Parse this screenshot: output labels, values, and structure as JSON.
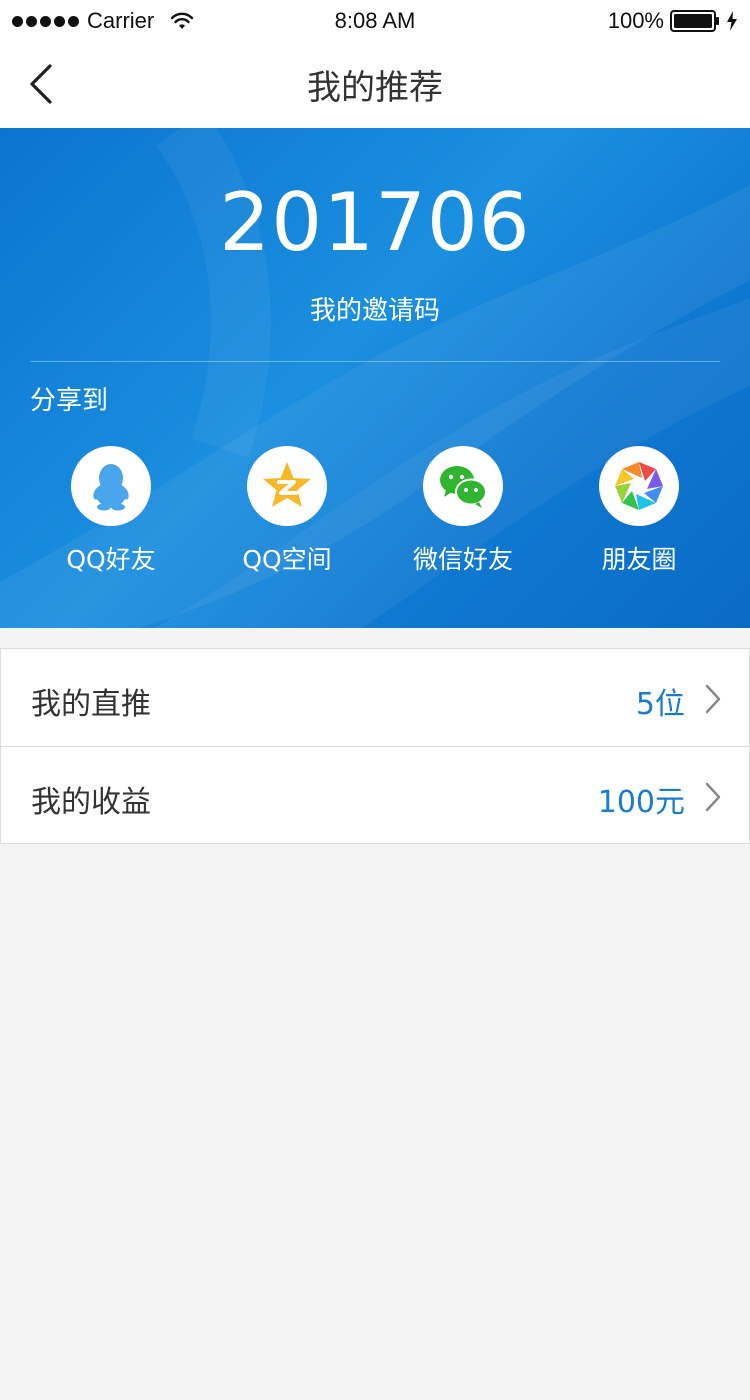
{
  "status_bar": {
    "carrier": "Carrier",
    "time": "8:08 AM",
    "battery": "100%",
    "icons": [
      "signal-dots-icon",
      "wifi-icon",
      "battery-icon",
      "charging-bolt-icon"
    ]
  },
  "nav": {
    "title": "我的推荐",
    "back_icon": "chevron-left-icon"
  },
  "hero": {
    "invite_code": "201706",
    "invite_label": "我的邀请码",
    "share_label": "分享到",
    "share_targets": [
      {
        "label": "QQ好友",
        "icon": "qq-penguin-icon"
      },
      {
        "label": "QQ空间",
        "icon": "qzone-star-icon"
      },
      {
        "label": "微信好友",
        "icon": "wechat-icon"
      },
      {
        "label": "朋友圈",
        "icon": "moments-aperture-icon"
      }
    ]
  },
  "list": [
    {
      "label": "我的直推",
      "value": "5位"
    },
    {
      "label": "我的收益",
      "value": "100元"
    }
  ],
  "colors": {
    "hero_blue": "#1b8fe0",
    "value_blue": "#1a7cd1",
    "page_bg": "#f4f4f4"
  }
}
